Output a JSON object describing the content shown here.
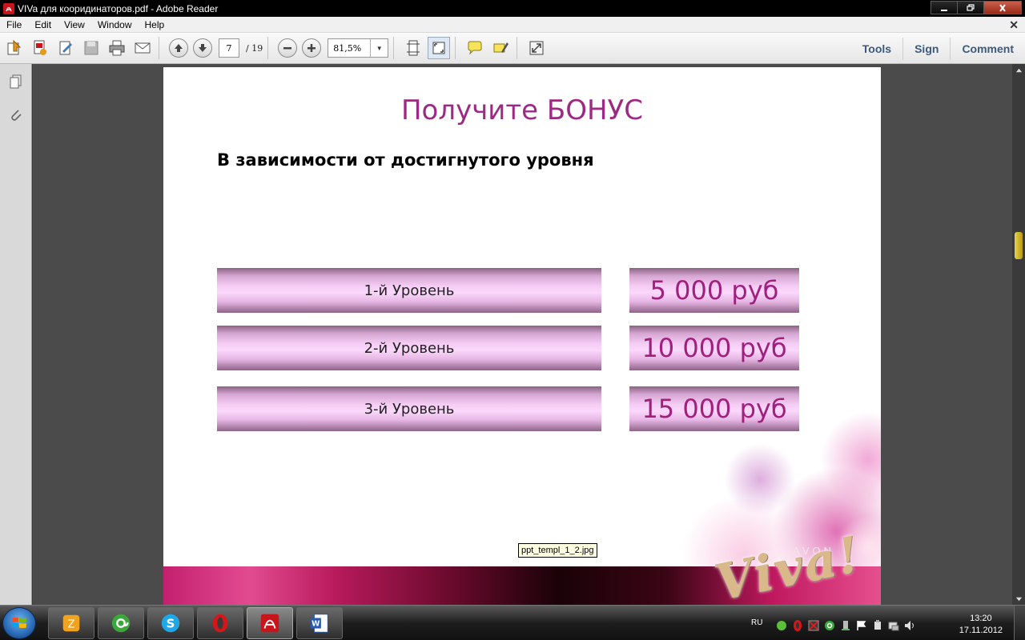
{
  "window": {
    "title": "VIVa для кооридинаторов.pdf - Adobe Reader"
  },
  "menu": {
    "items": [
      "File",
      "Edit",
      "View",
      "Window",
      "Help"
    ]
  },
  "toolbar": {
    "page_current": "7",
    "page_total": "/ 19",
    "zoom": "81,5%",
    "right_links": [
      "Tools",
      "Sign",
      "Comment"
    ]
  },
  "slide": {
    "title": "Получите БОНУС",
    "subtitle": "В зависимости от достигнутого уровня",
    "levels": [
      {
        "label": "1-й Уровень",
        "amount": "5 000 руб"
      },
      {
        "label": "2-й Уровень",
        "amount": "10 000 руб"
      },
      {
        "label": "3-й Уровень",
        "amount": "15 000 руб"
      }
    ],
    "brand_logo": "Viva!",
    "brand_name": "AVON"
  },
  "tooltip": "ppt_templ_1_2.jpg",
  "taskbar": {
    "language": "RU",
    "time": "13:20",
    "date": "17.11.2012"
  },
  "colors": {
    "title_magenta": "#9c2a82",
    "amount_magenta": "#a0207e",
    "bar_pink": "#fbd8fb"
  }
}
